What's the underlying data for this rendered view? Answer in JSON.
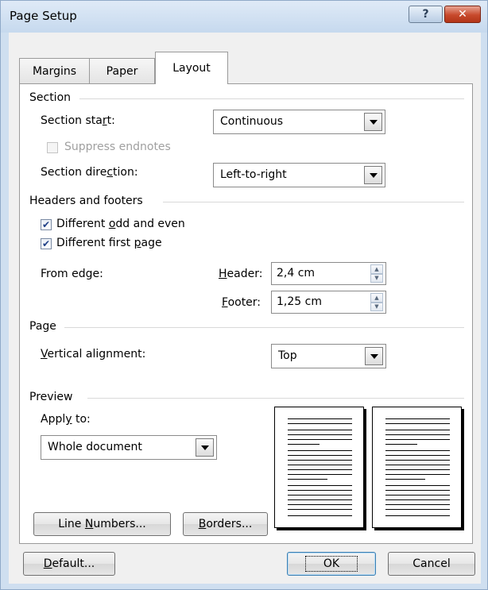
{
  "window": {
    "title": "Page Setup",
    "help_glyph": "?",
    "close_glyph": "✕"
  },
  "tabs": [
    {
      "label": "Margins",
      "active": false
    },
    {
      "label": "Paper",
      "active": false
    },
    {
      "label": "Layout",
      "active": true
    }
  ],
  "section": {
    "label": "Section",
    "section_start_label": "Section start:",
    "section_start_value": "Continuous",
    "suppress_endnotes_label": "Suppress endnotes",
    "suppress_endnotes_checked": false,
    "suppress_endnotes_enabled": false,
    "direction_label": "Section direction:",
    "direction_value": "Left-to-right"
  },
  "headers_footers": {
    "label": "Headers and footers",
    "odd_even_label": "Different odd and even",
    "odd_even_checked": true,
    "first_page_label": "Different first page",
    "first_page_checked": true,
    "from_edge_label": "From edge:",
    "header_label": "Header:",
    "header_value": "2,4 cm",
    "footer_label": "Footer:",
    "footer_value": "1,25 cm"
  },
  "page": {
    "label": "Page",
    "vertical_alignment_label": "Vertical alignment:",
    "vertical_alignment_value": "Top"
  },
  "preview": {
    "label": "Preview",
    "apply_to_label": "Apply to:",
    "apply_to_value": "Whole document"
  },
  "buttons": {
    "line_numbers": "Line Numbers...",
    "borders": "Borders...",
    "default": "Default...",
    "ok": "OK",
    "cancel": "Cancel"
  },
  "colors": {
    "title_bar": "#cfdff0",
    "close_button": "#c7492c",
    "check_mark": "#1f3f86"
  }
}
